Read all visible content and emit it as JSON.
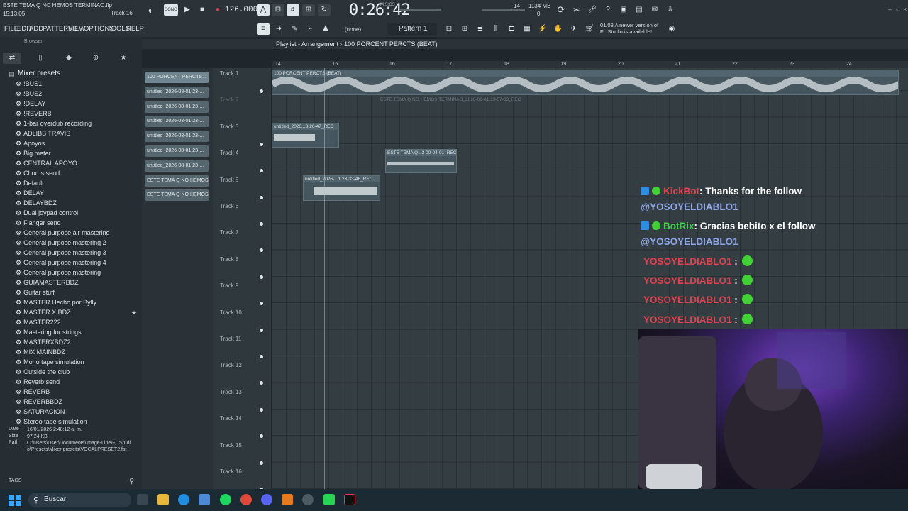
{
  "window": {
    "file_title": "ESTE TEMA Q NO HEMOS TERMINAO.flp",
    "clock_time": "15:13:05",
    "hint": "Track 16"
  },
  "transport": {
    "tempo": "126.000",
    "song_time": "0:26:42",
    "time_mode": "M:S:CS",
    "song_label": "SONG",
    "cpu": "14",
    "memory": "1134 MB",
    "memory_sub": "0"
  },
  "menu": {
    "items": [
      "FILE",
      "EDIT",
      "ADD",
      "PATTERNS",
      "VIEW",
      "OPTIONS",
      "TOOLS",
      "HELP"
    ],
    "none_label": "(none)",
    "pattern": "Pattern 1",
    "update_date": "01/08",
    "update_msg_1": "A newer version of",
    "update_msg_2": "FL Studio is available!"
  },
  "browser": {
    "header": "Browser",
    "folder": "Mixer presets",
    "presets": [
      "!BUS1",
      "!BUS2",
      "!DELAY",
      "!REVERB",
      "1-bar overdub recording",
      "ADLIBS TRAVIS",
      "Apoyos",
      "Big meter",
      "CENTRAL APOYO",
      "Chorus send",
      "Default",
      "DELAY",
      "DELAYBDZ",
      "Dual joypad control",
      "Flanger send",
      "General purpose air mastering",
      "General purpose mastering 2",
      "General purpose mastering 3",
      "General purpose mastering 4",
      "General purpose mastering",
      "GUIAMASTERBDZ",
      "Guitar stuff",
      "MASTER Hecho por Bylly",
      "MASTER X BDZ",
      "MASTER222",
      "Mastering for strings",
      "MASTERXBDZ2",
      "MIX MAINBDZ",
      "Mono tape simulation",
      "Outside the club",
      "Reverb send",
      "REVERB",
      "REVERBBDZ",
      "SATURACION",
      "Stereo tape simulation"
    ],
    "info_date_label": "Date",
    "info_date": "16/01/2026 2:48:12 a. m.",
    "info_size_label": "Size",
    "info_size": "97.24 KB",
    "info_path_label": "Path",
    "info_path_1": "C:\\Users\\User\\Documents\\Image-Line\\FL Studi",
    "info_path_2": "o\\Presets\\Mixer presets\\VOCALPRESET2.fst",
    "tags": "TAGS"
  },
  "picker": {
    "clips": [
      "100 PORCENT PERCTS...",
      "untitled_2026-08-01 23-...",
      "untitled_2026-08-01 23-...",
      "untitled_2026-08-01 23-...",
      "untitled_2026-08-01 23-...",
      "untitled_2026-08-01 23-...",
      "untitled_2026-08-01 23-...",
      "ESTE TEMA Q NO HEMOS T...",
      "ESTE TEMA Q NO HEMOS T..."
    ]
  },
  "playlist": {
    "title": "Playlist - Arrangement",
    "pattern_name": "100 PORCENT PERCTS (BEAT)",
    "bars": [
      "14",
      "15",
      "16",
      "17",
      "18",
      "19",
      "20",
      "21",
      "22",
      "23",
      "24"
    ],
    "tracks": [
      "Track 1",
      "Track 2",
      "Track 3",
      "Track 4",
      "Track 5",
      "Track 6",
      "Track 7",
      "Track 8",
      "Track 9",
      "Track 10",
      "Track 11",
      "Track 12",
      "Track 13",
      "Track 14",
      "Track 15",
      "Track 16"
    ],
    "clip_beat": "100 PORCENT PERCTS (BEAT)",
    "clip_ghost": "ESTE TEMA Q NO HEMOS TERMINAO_2026-08-01 23-57-33_REC",
    "clip_t3": "untitled_2026...3-26-47_REC",
    "clip_t4": "ESTE TEMA Q...2 00-04-01_REC",
    "clip_t5": "untitled_2026-...1 23-33-46_REC"
  },
  "chat": [
    {
      "user": "KickBot",
      "color": "#e0424f",
      "text": ": Thanks for the follow",
      "mention": "@YOSOYELDIABLO1"
    },
    {
      "user": "BotRix",
      "color": "#3fd14a",
      "text": ": Gracias bebito x el follow",
      "mention": "@YOSOYELDIABLO1"
    },
    {
      "user": "YOSOYELDIABLO1",
      "color": "#e0424f",
      "text": " :"
    },
    {
      "user": "YOSOYELDIABLO1",
      "color": "#e0424f",
      "text": " :"
    },
    {
      "user": "YOSOYELDIABLO1",
      "color": "#e0424f",
      "text": " :"
    },
    {
      "user": "YOSOYELDIABLO1",
      "color": "#e0424f",
      "text": " :"
    }
  ],
  "taskbar": {
    "search_label": "Buscar"
  }
}
